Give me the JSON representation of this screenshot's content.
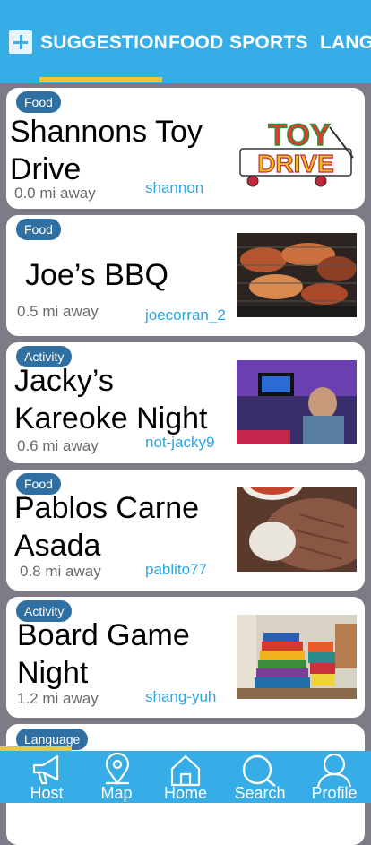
{
  "header": {
    "tabs": [
      "SUGGESTION",
      "FOOD",
      "SPORTS",
      "LANG"
    ]
  },
  "cards": [
    {
      "category": "Food",
      "title": "Shannons Toy Drive",
      "distance": "0.0 mi away",
      "user": "shannon",
      "image": "toy-drive-logo"
    },
    {
      "category": "Food",
      "title": "Joe’s BBQ",
      "distance": "0.5 mi away",
      "user": "joecorran_2",
      "image": "bbq-grill-photo"
    },
    {
      "category": "Activity",
      "title": "Jacky’s Kareoke Night",
      "distance": "0.6 mi away",
      "user": "not-jacky9",
      "image": "karaoke-photo"
    },
    {
      "category": "Food",
      "title": "Pablos Carne Asada",
      "distance": "0.8 mi away",
      "user": "pablito77",
      "image": "carne-asada-photo"
    },
    {
      "category": "Activity",
      "title": "Board Game Night",
      "distance": "1.2 mi away",
      "user": "shang-yuh",
      "image": "board-games-photo"
    },
    {
      "category": "Language"
    }
  ],
  "toy_logo": {
    "line1": "TOY",
    "line2": "DRIVE"
  },
  "nav": [
    "Host",
    "Map",
    "Home",
    "Search",
    "Profile"
  ],
  "colors": {
    "accent": "#36ade6",
    "indicator": "#f6c43b",
    "badge": "#2f6fa1",
    "username": "#2aa6e0"
  }
}
